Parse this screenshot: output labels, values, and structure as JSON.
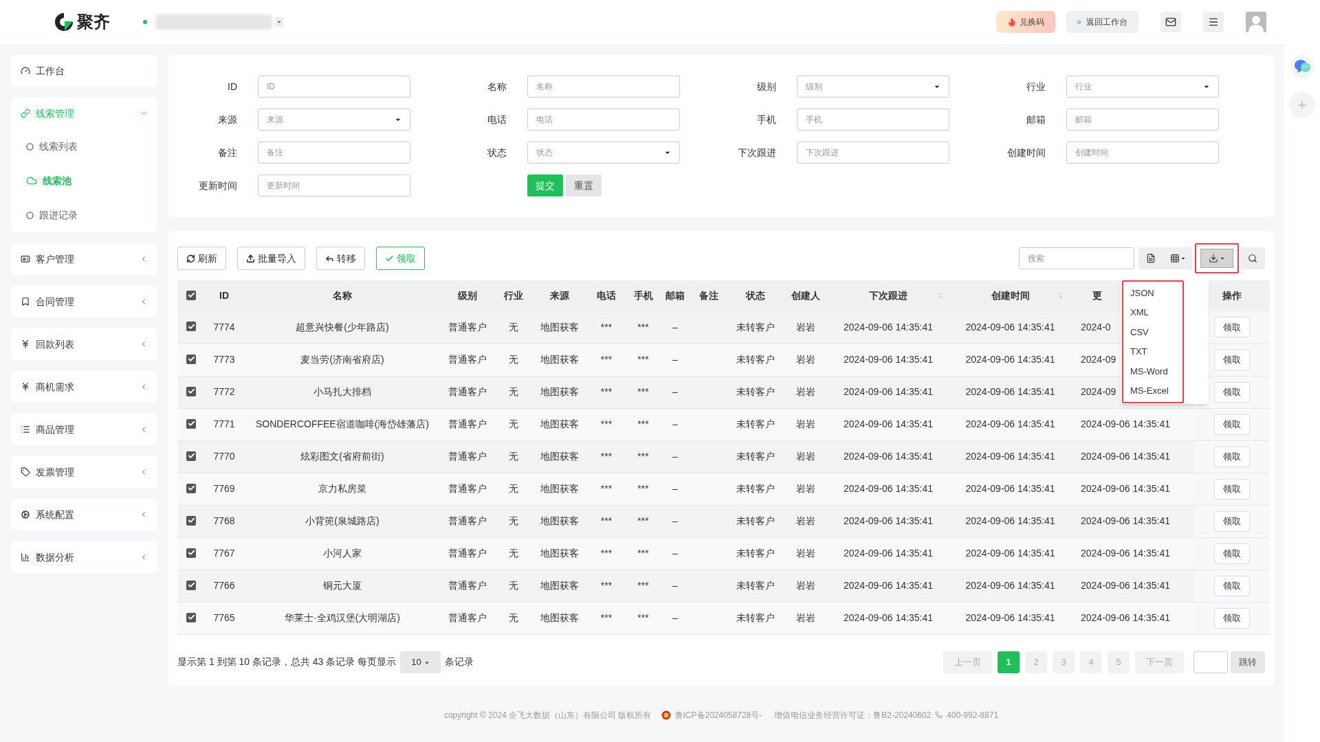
{
  "header": {
    "logo_text": "聚齐",
    "redeem_button": "兑换码",
    "back_button": "返回工作台"
  },
  "sidebar": {
    "items": [
      {
        "label": "工作台",
        "expanded": false
      },
      {
        "label": "线索管理",
        "expanded": true,
        "children": [
          {
            "label": "线索列表",
            "selected": false
          },
          {
            "label": "线索池",
            "selected": true
          },
          {
            "label": "跟进记录",
            "selected": false
          }
        ]
      },
      {
        "label": "客户管理",
        "expanded": false
      },
      {
        "label": "合同管理",
        "expanded": false
      },
      {
        "label": "回款列表",
        "expanded": false
      },
      {
        "label": "商机需求",
        "expanded": false
      },
      {
        "label": "商品管理",
        "expanded": false
      },
      {
        "label": "发票管理",
        "expanded": false
      },
      {
        "label": "系统配置",
        "expanded": false
      },
      {
        "label": "数据分析",
        "expanded": false
      }
    ]
  },
  "filters": [
    {
      "label": "ID",
      "placeholder": "ID",
      "kind": "input"
    },
    {
      "label": "名称",
      "placeholder": "名称",
      "kind": "input"
    },
    {
      "label": "级别",
      "placeholder": "级别",
      "kind": "select"
    },
    {
      "label": "行业",
      "placeholder": "行业",
      "kind": "select"
    },
    {
      "label": "来源",
      "placeholder": "来源",
      "kind": "select"
    },
    {
      "label": "电话",
      "placeholder": "电话",
      "kind": "input"
    },
    {
      "label": "手机",
      "placeholder": "手机",
      "kind": "input"
    },
    {
      "label": "邮箱",
      "placeholder": "邮箱",
      "kind": "input"
    },
    {
      "label": "备注",
      "placeholder": "备注",
      "kind": "input"
    },
    {
      "label": "状态",
      "placeholder": "状态",
      "kind": "select"
    },
    {
      "label": "下次跟进",
      "placeholder": "下次跟进",
      "kind": "input"
    },
    {
      "label": "创建时间",
      "placeholder": "创建时间",
      "kind": "input"
    },
    {
      "label": "更新时间",
      "placeholder": "更新时间",
      "kind": "input"
    }
  ],
  "form_buttons": {
    "submit": "提交",
    "reset": "重置"
  },
  "toolbar": {
    "buttons": [
      {
        "label": "刷新",
        "primary": false
      },
      {
        "label": "批量导入",
        "primary": false
      },
      {
        "label": "转移",
        "primary": false
      },
      {
        "label": "领取",
        "primary": true
      }
    ],
    "search_placeholder": "搜索"
  },
  "export_menu": {
    "open": true,
    "items": [
      "JSON",
      "XML",
      "CSV",
      "TXT",
      "MS-Word",
      "MS-Excel"
    ]
  },
  "table": {
    "header_checked": true,
    "columns": [
      {
        "label": "ID",
        "sortable": false
      },
      {
        "label": "名称",
        "sortable": false
      },
      {
        "label": "级别",
        "sortable": false
      },
      {
        "label": "行业",
        "sortable": false
      },
      {
        "label": "来源",
        "sortable": false
      },
      {
        "label": "电话",
        "sortable": false
      },
      {
        "label": "手机",
        "sortable": false
      },
      {
        "label": "邮箱",
        "sortable": false
      },
      {
        "label": "备注",
        "sortable": false
      },
      {
        "label": "状态",
        "sortable": false
      },
      {
        "label": "创建人",
        "sortable": false
      },
      {
        "label": "下次跟进",
        "sortable": true
      },
      {
        "label": "创建时间",
        "sortable": true
      },
      {
        "label": "更",
        "sortable": false
      },
      {
        "label": "操作",
        "sortable": false
      }
    ],
    "rows": [
      {
        "checked": true,
        "cells": [
          "7774",
          "超意兴快餐(少年路店)",
          "普通客户",
          "无",
          "地图获客",
          "***",
          "***",
          "–",
          "",
          "未转客户",
          "岩岩",
          "2024-09-06 14:35:41",
          "2024-09-06 14:35:41",
          "2024-0"
        ],
        "action": "领取"
      },
      {
        "checked": true,
        "cells": [
          "7773",
          "麦当劳(济南省府店)",
          "普通客户",
          "无",
          "地图获客",
          "***",
          "***",
          "–",
          "",
          "未转客户",
          "岩岩",
          "2024-09-06 14:35:41",
          "2024-09-06 14:35:41",
          "2024-09"
        ],
        "action": "领取"
      },
      {
        "checked": true,
        "cells": [
          "7772",
          "小马扎大排档",
          "普通客户",
          "无",
          "地图获客",
          "***",
          "***",
          "–",
          "",
          "未转客户",
          "岩岩",
          "2024-09-06 14:35:41",
          "2024-09-06 14:35:41",
          "2024-09"
        ],
        "action": "领取"
      },
      {
        "checked": true,
        "cells": [
          "7771",
          "SONDERCOFFEE宿道咖啡(海岱雄藩店)",
          "普通客户",
          "无",
          "地图获客",
          "***",
          "***",
          "–",
          "",
          "未转客户",
          "岩岩",
          "2024-09-06 14:35:41",
          "2024-09-06 14:35:41",
          "2024-09-06 14:35:41"
        ],
        "action": "领取"
      },
      {
        "checked": true,
        "cells": [
          "7770",
          "炫彩图文(省府前街)",
          "普通客户",
          "无",
          "地图获客",
          "***",
          "***",
          "–",
          "",
          "未转客户",
          "岩岩",
          "2024-09-06 14:35:41",
          "2024-09-06 14:35:41",
          "2024-09-06 14:35:41"
        ],
        "action": "领取"
      },
      {
        "checked": true,
        "cells": [
          "7769",
          "京力私房菜",
          "普通客户",
          "无",
          "地图获客",
          "***",
          "***",
          "–",
          "",
          "未转客户",
          "岩岩",
          "2024-09-06 14:35:41",
          "2024-09-06 14:35:41",
          "2024-09-06 14:35:41"
        ],
        "action": "领取"
      },
      {
        "checked": true,
        "cells": [
          "7768",
          "小背篼(泉城路店)",
          "普通客户",
          "无",
          "地图获客",
          "***",
          "***",
          "–",
          "",
          "未转客户",
          "岩岩",
          "2024-09-06 14:35:41",
          "2024-09-06 14:35:41",
          "2024-09-06 14:35:41"
        ],
        "action": "领取"
      },
      {
        "checked": true,
        "cells": [
          "7767",
          "小河人家",
          "普通客户",
          "无",
          "地图获客",
          "***",
          "***",
          "–",
          "",
          "未转客户",
          "岩岩",
          "2024-09-06 14:35:41",
          "2024-09-06 14:35:41",
          "2024-09-06 14:35:41"
        ],
        "action": "领取"
      },
      {
        "checked": true,
        "cells": [
          "7766",
          "铜元大厦",
          "普通客户",
          "无",
          "地图获客",
          "***",
          "***",
          "–",
          "",
          "未转客户",
          "岩岩",
          "2024-09-06 14:35:41",
          "2024-09-06 14:35:41",
          "2024-09-06 14:35:41"
        ],
        "action": "领取"
      },
      {
        "checked": true,
        "cells": [
          "7765",
          "华莱士·全鸡汉堡(大明湖店)",
          "普通客户",
          "无",
          "地图获客",
          "***",
          "***",
          "–",
          "",
          "未转客户",
          "岩岩",
          "2024-09-06 14:35:41",
          "2024-09-06 14:35:41",
          "2024-09-06 14:35:41"
        ],
        "action": "领取"
      }
    ]
  },
  "pagination": {
    "summary_before": "显示第 1 到第 10 条记录，总共 43 条记录 每页显示",
    "page_size": "10",
    "summary_after": "条记录",
    "prev": "上一页",
    "pages": [
      {
        "label": "1",
        "selected": true
      },
      {
        "label": "2",
        "selected": false
      },
      {
        "label": "3",
        "selected": false
      },
      {
        "label": "4",
        "selected": false
      },
      {
        "label": "5",
        "selected": false
      }
    ],
    "next": "下一页",
    "jump": "跳转"
  },
  "footer": {
    "copyright": "copyright © 2024 企飞大数据（山东）有限公司 版权所有",
    "icp": "鲁ICP备2024058728号-",
    "license": "增值电信业务经营许可证：鲁B2-20240602",
    "phone": "400-992-8871"
  }
}
